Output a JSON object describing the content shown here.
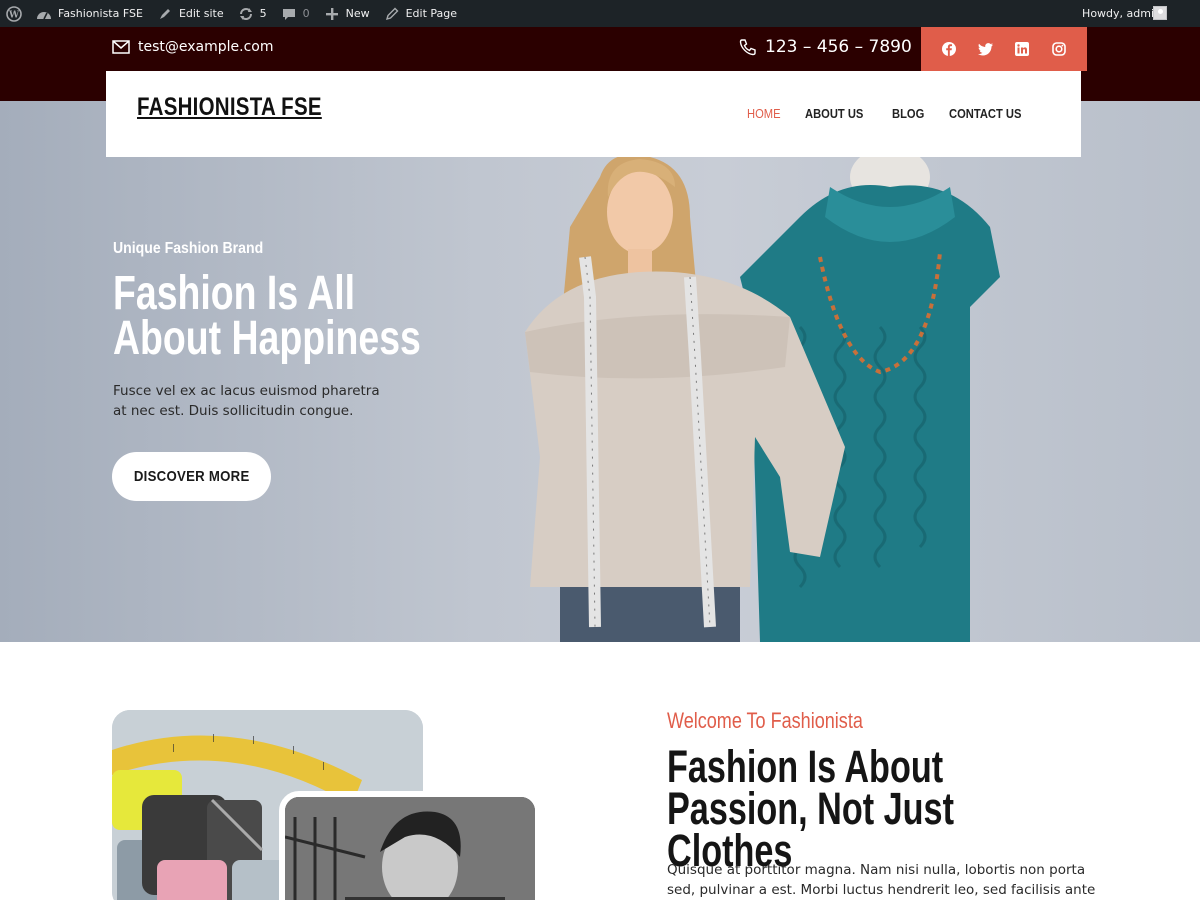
{
  "adminbar": {
    "site_name": "Fashionista FSE",
    "edit_site": "Edit site",
    "updates_count": "5",
    "comments_count": "0",
    "new_label": "New",
    "edit_page": "Edit Page",
    "howdy": "Howdy, admin",
    "icons": [
      "wordpress-icon",
      "dashboard-icon",
      "pencil-brush-icon",
      "updates-icon",
      "comment-icon",
      "plus-icon",
      "edit-icon",
      "avatar-icon"
    ]
  },
  "topbar": {
    "email": "test@example.com",
    "phone": "123 – 456 – 7890",
    "social": [
      "facebook-icon",
      "twitter-icon",
      "linkedin-icon",
      "instagram-icon"
    ]
  },
  "header": {
    "site_title": "FASHIONISTA FSE",
    "nav": [
      {
        "label": "HOME",
        "active": true
      },
      {
        "label": "ABOUT US",
        "active": false
      },
      {
        "label": "BLOG",
        "active": false
      },
      {
        "label": "CONTACT US",
        "active": false
      }
    ]
  },
  "hero": {
    "subtitle": "Unique Fashion Brand",
    "title": "Fashion Is All About Happiness",
    "text": "Fusce vel ex ac lacus euismod pharetra at nec est. Duis sollicitudin congue.",
    "button": "DISCOVER MORE"
  },
  "about": {
    "subtitle": "Welcome To Fashionista",
    "title": "Fashion Is About Passion, Not Just Clothes",
    "text": "Quisque at porttitor magna. Nam nisi nulla, lobortis non porta sed, pulvinar a est. Morbi luctus hendrerit leo, sed facilisis ante"
  },
  "colors": {
    "accent": "#e05d4a",
    "topbar_bg": "#2b0000",
    "adminbar_bg": "#1d2327",
    "hero_bg": "#b8bfca"
  }
}
